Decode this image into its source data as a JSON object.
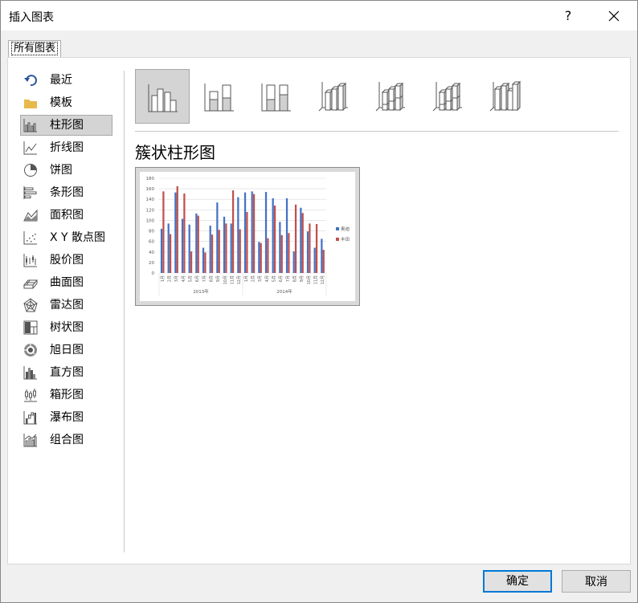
{
  "window": {
    "title": "插入图表",
    "help_label": "?"
  },
  "tabs": [
    {
      "label": "所有图表"
    }
  ],
  "sidebar": {
    "items": [
      {
        "label": "最近",
        "icon": "undo-arrow-icon",
        "selected": false
      },
      {
        "label": "模板",
        "icon": "folder-icon",
        "selected": false
      },
      {
        "label": "柱形图",
        "icon": "column-chart-icon",
        "selected": true
      },
      {
        "label": "折线图",
        "icon": "line-chart-icon",
        "selected": false
      },
      {
        "label": "饼图",
        "icon": "pie-chart-icon",
        "selected": false
      },
      {
        "label": "条形图",
        "icon": "bar-chart-icon",
        "selected": false
      },
      {
        "label": "面积图",
        "icon": "area-chart-icon",
        "selected": false
      },
      {
        "label": "X Y 散点图",
        "icon": "scatter-chart-icon",
        "selected": false
      },
      {
        "label": "股价图",
        "icon": "stock-chart-icon",
        "selected": false
      },
      {
        "label": "曲面图",
        "icon": "surface-chart-icon",
        "selected": false
      },
      {
        "label": "雷达图",
        "icon": "radar-chart-icon",
        "selected": false
      },
      {
        "label": "树状图",
        "icon": "treemap-chart-icon",
        "selected": false
      },
      {
        "label": "旭日图",
        "icon": "sunburst-chart-icon",
        "selected": false
      },
      {
        "label": "直方图",
        "icon": "histogram-chart-icon",
        "selected": false
      },
      {
        "label": "箱形图",
        "icon": "box-whisker-chart-icon",
        "selected": false
      },
      {
        "label": "瀑布图",
        "icon": "waterfall-chart-icon",
        "selected": false
      },
      {
        "label": "组合图",
        "icon": "combo-chart-icon",
        "selected": false
      }
    ]
  },
  "subtypes": [
    {
      "icon": "clustered-column-icon",
      "selected": true
    },
    {
      "icon": "stacked-column-icon",
      "selected": false
    },
    {
      "icon": "100-stacked-column-icon",
      "selected": false
    },
    {
      "icon": "3d-clustered-column-icon",
      "selected": false
    },
    {
      "icon": "3d-stacked-column-icon",
      "selected": false
    },
    {
      "icon": "3d-100-stacked-column-icon",
      "selected": false
    },
    {
      "icon": "3d-column-icon",
      "selected": false
    }
  ],
  "selected_chart_name": "簇状柱形图",
  "chart_data": {
    "type": "bar",
    "categories": [
      "1月",
      "2月",
      "3月",
      "4月",
      "5月",
      "6月",
      "7月",
      "8月",
      "9月",
      "10月",
      "11月",
      "12月",
      "1月",
      "2月",
      "3月",
      "4月",
      "5月",
      "6月",
      "7月",
      "8月",
      "9月",
      "10月",
      "11月",
      "12月"
    ],
    "groups": [
      {
        "label": "2013年",
        "span": 12
      },
      {
        "label": "2014年",
        "span": 12
      }
    ],
    "series": [
      {
        "name": "奥迪",
        "color": "#4472c4",
        "values": [
          84,
          94,
          153,
          103,
          92,
          113,
          48,
          90,
          134,
          107,
          94,
          144,
          153,
          155,
          59,
          154,
          142,
          97,
          142,
          41,
          124,
          79,
          48,
          65
        ]
      },
      {
        "name": "丰田",
        "color": "#c0504d",
        "values": [
          155,
          74,
          165,
          151,
          41,
          109,
          39,
          73,
          82,
          94,
          157,
          83,
          116,
          150,
          57,
          66,
          128,
          72,
          76,
          130,
          114,
          94,
          93,
          44
        ]
      }
    ],
    "ylim": [
      0,
      180
    ],
    "yticks": [
      0,
      20,
      40,
      60,
      80,
      100,
      120,
      140,
      160,
      180
    ],
    "legend": "right",
    "grid": true
  },
  "buttons": {
    "ok": "确定",
    "cancel": "取消"
  }
}
